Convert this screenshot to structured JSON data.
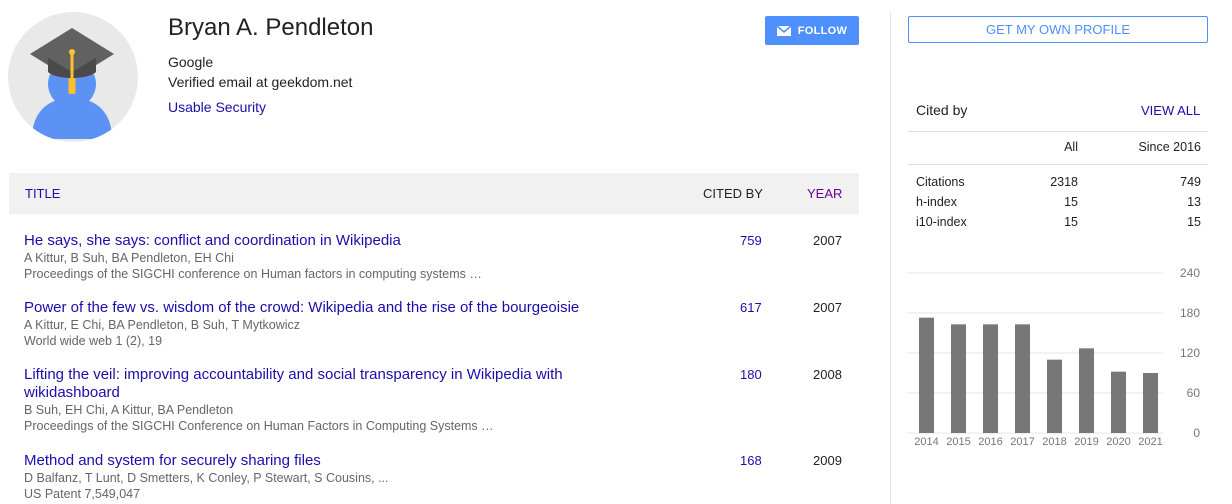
{
  "profile": {
    "name": "Bryan A. Pendleton",
    "affiliation": "Google",
    "email": "Verified email at geekdom.net",
    "interest": "Usable Security",
    "follow_label": "FOLLOW"
  },
  "table": {
    "col_title": "TITLE",
    "col_cited": "CITED BY",
    "col_year": "YEAR",
    "rows": [
      {
        "title": "He says, she says: conflict and coordination in Wikipedia",
        "authors": "A Kittur, B Suh, BA Pendleton, EH Chi",
        "venue": "Proceedings of the SIGCHI conference on Human factors in computing systems …",
        "cited": "759",
        "year": "2007"
      },
      {
        "title": "Power of the few vs. wisdom of the crowd: Wikipedia and the rise of the bourgeoisie",
        "authors": "A Kittur, E Chi, BA Pendleton, B Suh, T Mytkowicz",
        "venue": "World wide web 1 (2), 19",
        "cited": "617",
        "year": "2007"
      },
      {
        "title": "Lifting the veil: improving accountability and social transparency in Wikipedia with wikidashboard",
        "authors": "B Suh, EH Chi, A Kittur, BA Pendleton",
        "venue": "Proceedings of the SIGCHI Conference on Human Factors in Computing Systems …",
        "cited": "180",
        "year": "2008"
      },
      {
        "title": "Method and system for securely sharing files",
        "authors": "D Balfanz, T Lunt, D Smetters, K Conley, P Stewart, S Cousins, ...",
        "venue": "US Patent 7,549,047",
        "cited": "168",
        "year": "2009"
      }
    ]
  },
  "sidebar": {
    "profile_button": "GET MY OWN PROFILE",
    "cited_by": "Cited by",
    "view_all": "VIEW ALL",
    "col_all": "All",
    "col_since": "Since 2016",
    "stats": [
      {
        "label": "Citations",
        "all": "2318",
        "since": "749"
      },
      {
        "label": "h-index",
        "all": "15",
        "since": "13"
      },
      {
        "label": "i10-index",
        "all": "15",
        "since": "15"
      }
    ]
  },
  "colors": {
    "link": "#1a0dab",
    "accent": "#4d90fe",
    "bar": "#777777"
  },
  "chart_data": {
    "type": "bar",
    "categories": [
      "2014",
      "2015",
      "2016",
      "2017",
      "2018",
      "2019",
      "2020",
      "2021"
    ],
    "values": [
      173,
      163,
      163,
      163,
      110,
      127,
      92,
      90
    ],
    "yticks": [
      "0",
      "60",
      "120",
      "180",
      "240"
    ],
    "ylim": [
      0,
      240
    ]
  }
}
